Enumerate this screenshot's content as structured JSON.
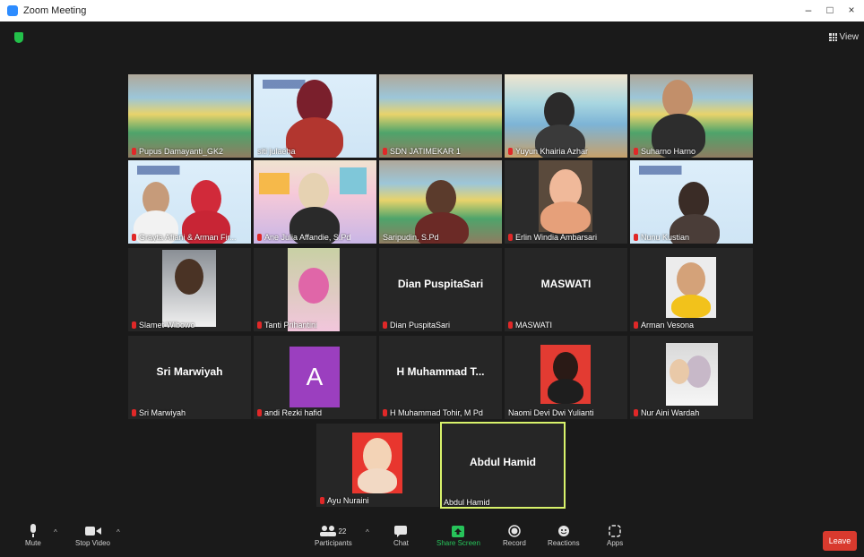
{
  "window": {
    "title": "Zoom Meeting",
    "controls": [
      "–",
      "□",
      "×"
    ]
  },
  "view_label": "View",
  "participants": [
    {
      "name": "Pupus Damayanti_GK2",
      "muted": true
    },
    {
      "name": "siti julaeha",
      "muted": false
    },
    {
      "name": "SDN JATIMEKAR 1",
      "muted": true
    },
    {
      "name": "Yuyun Khairia Azhar",
      "muted": true
    },
    {
      "name": "Suharno Harno",
      "muted": true
    },
    {
      "name": "Grayta Afiani & Arman Fir...",
      "muted": true
    },
    {
      "name": "Ane Julia Affandie, S.Pd",
      "muted": true
    },
    {
      "name": "Saripudin, S.Pd",
      "muted": false
    },
    {
      "name": "Erlin Windia Ambarsari",
      "muted": true
    },
    {
      "name": "Nunu Kustian",
      "muted": true
    },
    {
      "name": "Slamet Wibowo",
      "muted": true
    },
    {
      "name": "Tanti Prihantini",
      "muted": true
    },
    {
      "name": "Dian PuspitaSari",
      "muted": true,
      "display_name": "Dian PuspitaSari"
    },
    {
      "name": "MASWATI",
      "muted": true,
      "display_name": "MASWATI"
    },
    {
      "name": "Arman Vesona",
      "muted": true
    },
    {
      "name": "Sri Marwiyah",
      "muted": true,
      "display_name": "Sri Marwiyah"
    },
    {
      "name": "andi Rezki hafid",
      "muted": true,
      "avatar_letter": "A"
    },
    {
      "name": "H Muhammad Tohir, M Pd",
      "muted": true,
      "display_name": "H Muhammad T..."
    },
    {
      "name": "Naomi Devi Dwi Yulianti",
      "muted": false
    },
    {
      "name": "Nur Aini Wardah",
      "muted": true
    },
    {
      "name": "Ayu Nuraini",
      "muted": true
    },
    {
      "name": "Abdul Hamid",
      "muted": false,
      "display_name": "Abdul Hamid",
      "active_speaker": true
    }
  ],
  "toolbar": {
    "mute": "Mute",
    "stop_video": "Stop Video",
    "participants": "Participants",
    "participants_count": "22",
    "chat": "Chat",
    "share_screen": "Share Screen",
    "record": "Record",
    "reactions": "Reactions",
    "apps": "Apps",
    "leave": "Leave"
  },
  "colors": {
    "accent_green": "#27c35a",
    "leave_red": "#d93a2e",
    "active_border": "#d8f26b",
    "avatar_purple": "#9b3fbf"
  }
}
